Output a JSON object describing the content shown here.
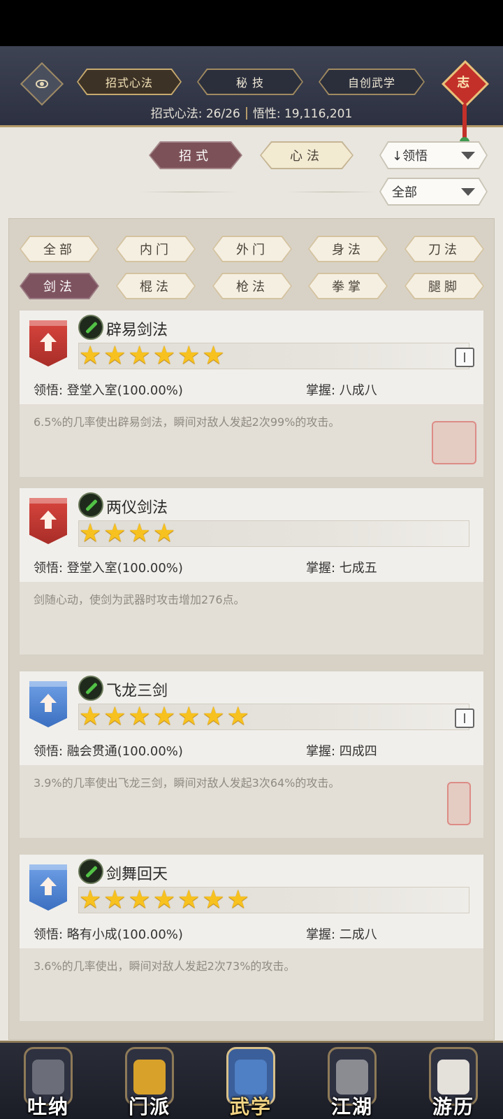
{
  "header": {
    "tabs": [
      {
        "label": "招式心法",
        "active": true
      },
      {
        "label": "秘 技",
        "active": false
      },
      {
        "label": "自创武学",
        "active": false
      }
    ],
    "stats": {
      "count_label": "招式心法: 26/26",
      "insight_label": "悟性: 19,116,201"
    },
    "knot_icon": "志"
  },
  "subtabs": [
    {
      "label": "招式",
      "active": true
    },
    {
      "label": "心法",
      "active": false
    }
  ],
  "sort_dropdown": {
    "value": "↓领悟"
  },
  "filter_dropdown": {
    "value": "全部"
  },
  "categories": [
    {
      "label": "全部",
      "active": false
    },
    {
      "label": "内门",
      "active": false
    },
    {
      "label": "外门",
      "active": false
    },
    {
      "label": "身法",
      "active": false
    },
    {
      "label": "刀法",
      "active": false
    },
    {
      "label": "剑法",
      "active": true
    },
    {
      "label": "棍法",
      "active": false
    },
    {
      "label": "枪法",
      "active": false
    },
    {
      "label": "拳掌",
      "active": false
    },
    {
      "label": "腿脚",
      "active": false
    }
  ],
  "skills": [
    {
      "name": "辟易剑法",
      "stars": 6,
      "stars_text": "★★★★★★",
      "banner_color": "red",
      "comprehension": "领悟: 登堂入室(100.00%)",
      "mastery": "掌握: 八成八",
      "description": "6.5%的几率使出辟易剑法，瞬间对敌人发起2次99%的攻击。"
    },
    {
      "name": "两仪剑法",
      "stars": 4,
      "stars_text": "★★★★",
      "banner_color": "red",
      "comprehension": "领悟: 登堂入室(100.00%)",
      "mastery": "掌握: 七成五",
      "description": "剑随心动，使剑为武器时攻击增加276点。"
    },
    {
      "name": "飞龙三剑",
      "stars": 7,
      "stars_text": "★★★★★★★",
      "banner_color": "blue",
      "comprehension": "领悟: 融会贯通(100.00%)",
      "mastery": "掌握: 四成四",
      "description": "3.9%的几率使出飞龙三剑，瞬间对敌人发起3次64%的攻击。"
    },
    {
      "name": "剑舞回天",
      "stars": 7,
      "stars_text": "★★★★★★★",
      "banner_color": "blue",
      "comprehension": "领悟: 略有小成(100.00%)",
      "mastery": "掌握: 二成八",
      "description": "3.6%的几率使出，瞬间对敌人发起2次73%的攻击。"
    }
  ],
  "bottom_nav": [
    {
      "label": "吐纳",
      "active": false
    },
    {
      "label": "门派",
      "active": false
    },
    {
      "label": "武学",
      "active": true
    },
    {
      "label": "江湖",
      "active": false
    },
    {
      "label": "游历",
      "active": false
    }
  ]
}
